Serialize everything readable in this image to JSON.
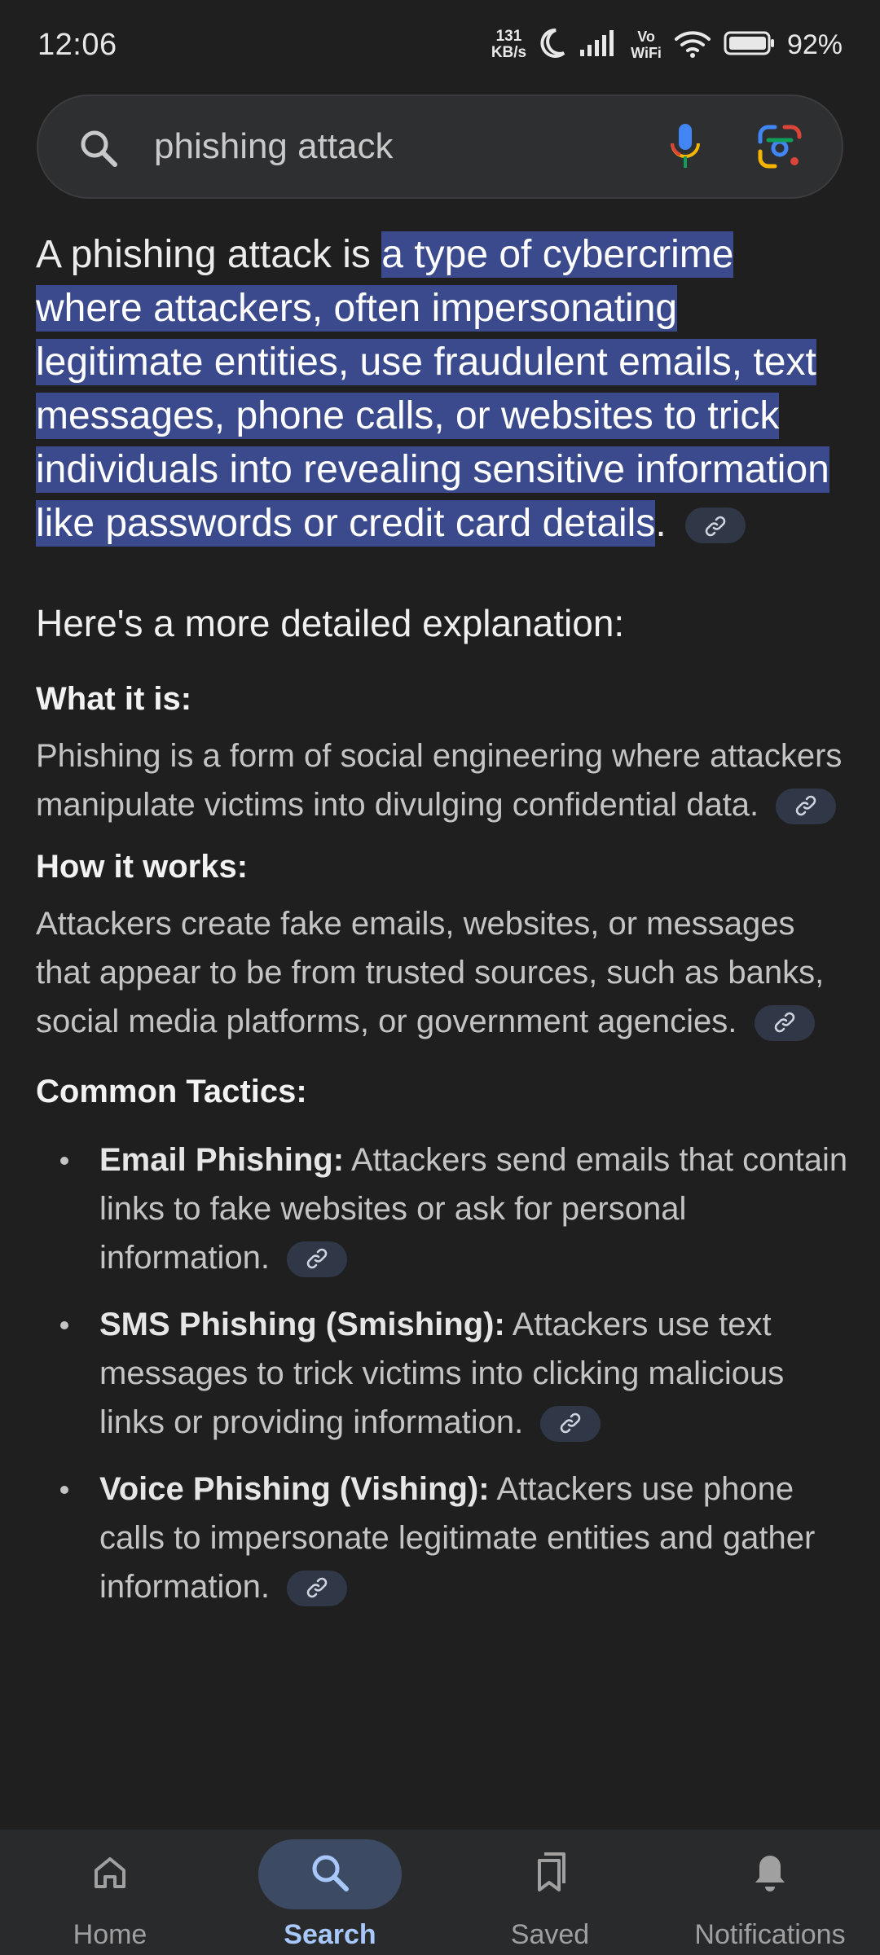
{
  "status_bar": {
    "time": "12:06",
    "netspeed_value": "131",
    "netspeed_unit": "KB/s",
    "vo_top": "Vo",
    "vo_bottom": "WiFi",
    "battery": "92%"
  },
  "search": {
    "query": "phishing attack"
  },
  "answer": {
    "intro_plain": "A phishing attack is ",
    "intro_highlight": "a type of cybercrime where attackers, often impersonating legitimate entities, use fraudulent emails, text messages, phone calls, or websites to trick individuals into revealing sensitive information like passwords or credit card details",
    "intro_end": ".",
    "section_heading": "Here's a more detailed explanation:",
    "what_title": "What it is:",
    "what_text": "Phishing is a form of social engineering where attackers manipulate victims into divulging confidential data.",
    "how_title": "How it works:",
    "how_text": "Attackers create fake emails, websites, or messages that appear to be from trusted sources, such as banks, social media platforms, or government agencies.",
    "tactics_title": "Common Tactics:",
    "tactics": [
      {
        "name": "Email Phishing:",
        "text": " Attackers send emails that contain links to fake websites or ask for personal information."
      },
      {
        "name": "SMS Phishing (Smishing):",
        "text": " Attackers use text messages to trick victims into clicking malicious links or providing information."
      },
      {
        "name": "Voice Phishing (Vishing):",
        "text": " Attackers use phone calls to impersonate legitimate entities and gather information."
      }
    ]
  },
  "bottom_nav": [
    {
      "label": "Home",
      "icon": "home-icon",
      "active": false
    },
    {
      "label": "Search",
      "icon": "search-icon",
      "active": true
    },
    {
      "label": "Saved",
      "icon": "bookmark-icon",
      "active": false
    },
    {
      "label": "Notifications",
      "icon": "bell-icon",
      "active": false
    }
  ],
  "colors": {
    "background": "#1f1f1f",
    "highlight": "#3a4a8c",
    "active_nav": "#a8c7fa"
  }
}
